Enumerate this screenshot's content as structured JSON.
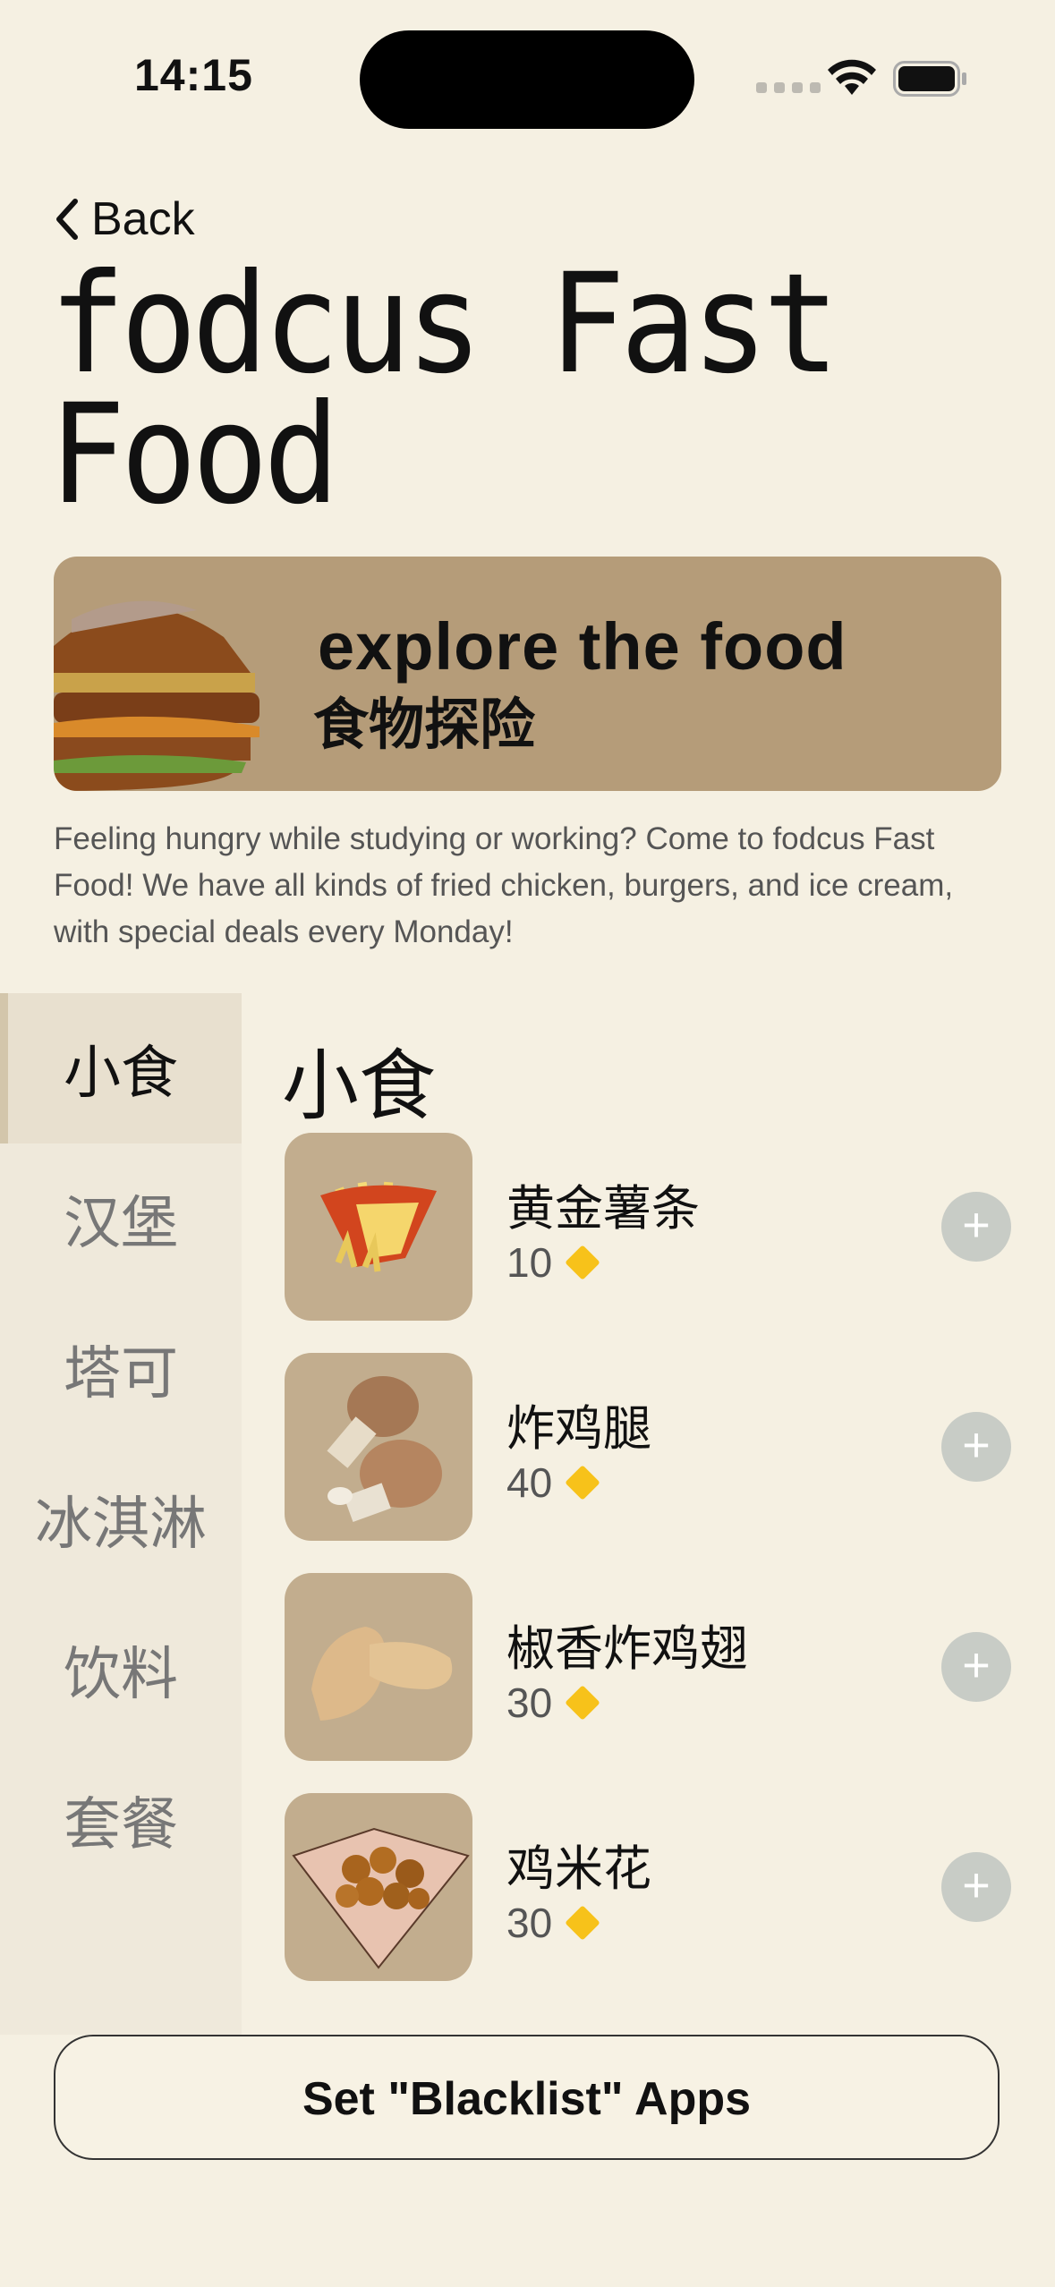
{
  "status_bar": {
    "time": "14:15"
  },
  "nav": {
    "back_label": "Back"
  },
  "store": {
    "title": "fodcus Fast Food",
    "banner_en": "explore the food",
    "banner_zh": "食物探险",
    "description": "Feeling hungry while studying or working? Come to fodcus Fast Food! We have all kinds of fried chicken, burgers, and ice cream, with special deals every Monday!"
  },
  "categories": [
    "小食",
    "汉堡",
    "塔可",
    "冰淇淋",
    "饮料",
    "套餐"
  ],
  "selected_category": "小食",
  "section": {
    "title": "小食"
  },
  "items": [
    {
      "name": "黄金薯条",
      "price": "10",
      "icon": "fries-icon"
    },
    {
      "name": "炸鸡腿",
      "price": "40",
      "icon": "drumstick-icon"
    },
    {
      "name": "椒香炸鸡翅",
      "price": "30",
      "icon": "chicken-wing-icon"
    },
    {
      "name": "鸡米花",
      "price": "30",
      "icon": "popcorn-chicken-icon"
    }
  ],
  "cta": {
    "label": "Set \"Blacklist\" Apps"
  },
  "colors": {
    "background": "#f5f0e2",
    "banner": "#b59c79",
    "gem": "#f7c21a",
    "sidebar": "#efe9db"
  }
}
